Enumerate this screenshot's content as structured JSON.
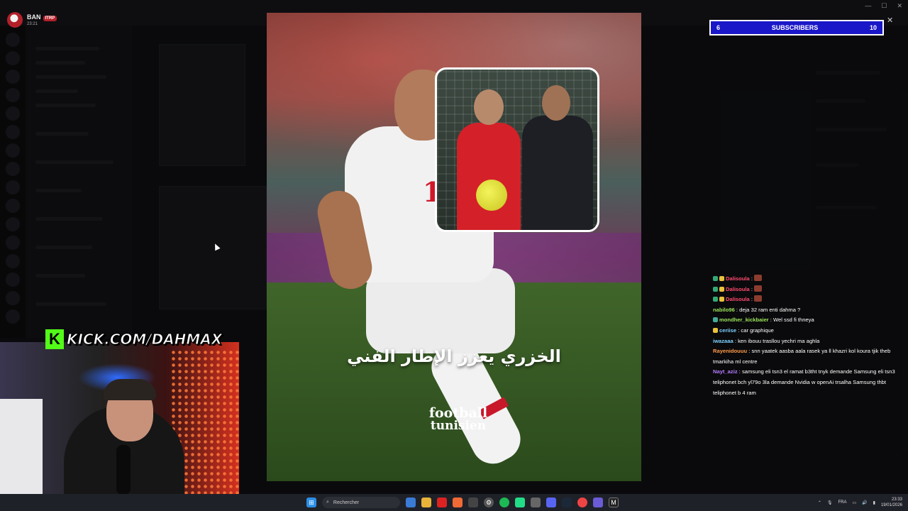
{
  "streamer": {
    "name": "BAN",
    "badge": "ITRP",
    "time": "23:21"
  },
  "subscribers": {
    "current": "6",
    "label": "SUBSCRIBERS",
    "goal": "10"
  },
  "post": {
    "caption": "الخزري يعزز الإطار الفني",
    "brand_line1": "football",
    "brand_line2": "tunisien",
    "jersey_number": "10"
  },
  "kick": {
    "logo": "K",
    "url": "KICK.COM/DAHMAX"
  },
  "chat": [
    {
      "user": "Dalisoula",
      "color": "#ff4a6e",
      "text": "",
      "badges": [
        "#3a7",
        "#e9c13b"
      ],
      "emote": true
    },
    {
      "user": "Dalisoula",
      "color": "#ff4a6e",
      "text": "",
      "badges": [
        "#3a7",
        "#e9c13b"
      ],
      "emote": true
    },
    {
      "user": "Dalisoula",
      "color": "#ff4a6e",
      "text": "",
      "badges": [
        "#3a7",
        "#e9c13b"
      ],
      "emote": true
    },
    {
      "user": "nabilo96",
      "color": "#9ce65a",
      "text": "deja 32 ram enti dahma ?",
      "badges": [],
      "emote": false
    },
    {
      "user": "mondher_kickbaier",
      "color": "#9ce65a",
      "text": "Wel ssd fi thneya",
      "badges": [
        "#4a9"
      ],
      "emote": false
    },
    {
      "user": "ceriise",
      "color": "#7fd3ff",
      "text": "car graphique",
      "badges": [
        "#e9c13b"
      ],
      "emote": false
    },
    {
      "user": "iwazaaa",
      "color": "#7fd3ff",
      "text": "ken ibouu trasllou yechri ma aghla",
      "badges": [],
      "emote": false
    },
    {
      "user": "Rayenidouuu",
      "color": "#ff9b4a",
      "text": "snn yaatek aasba aala rasek ya ll khazri kol koura tjik theb tmarkiha ml centre",
      "badges": [],
      "emote": false
    },
    {
      "user": "Nayt_aziz",
      "color": "#b57bff",
      "text": "samsung eli tsn3 el ramat b3tht tnyk demande Samsung eli tsn3 teliphonet bch yl79o 3la demande Nvidia w openAi trsalha Samsung thbt teliphonet b 4 ram",
      "badges": [],
      "emote": false
    }
  ],
  "taskbar": {
    "search_placeholder": "Rechercher",
    "language": "FRA",
    "time": "23:33",
    "date": "19/01/2026"
  },
  "colors": {
    "kick_green": "#53fc18",
    "subs_blue": "#1a17c9"
  }
}
